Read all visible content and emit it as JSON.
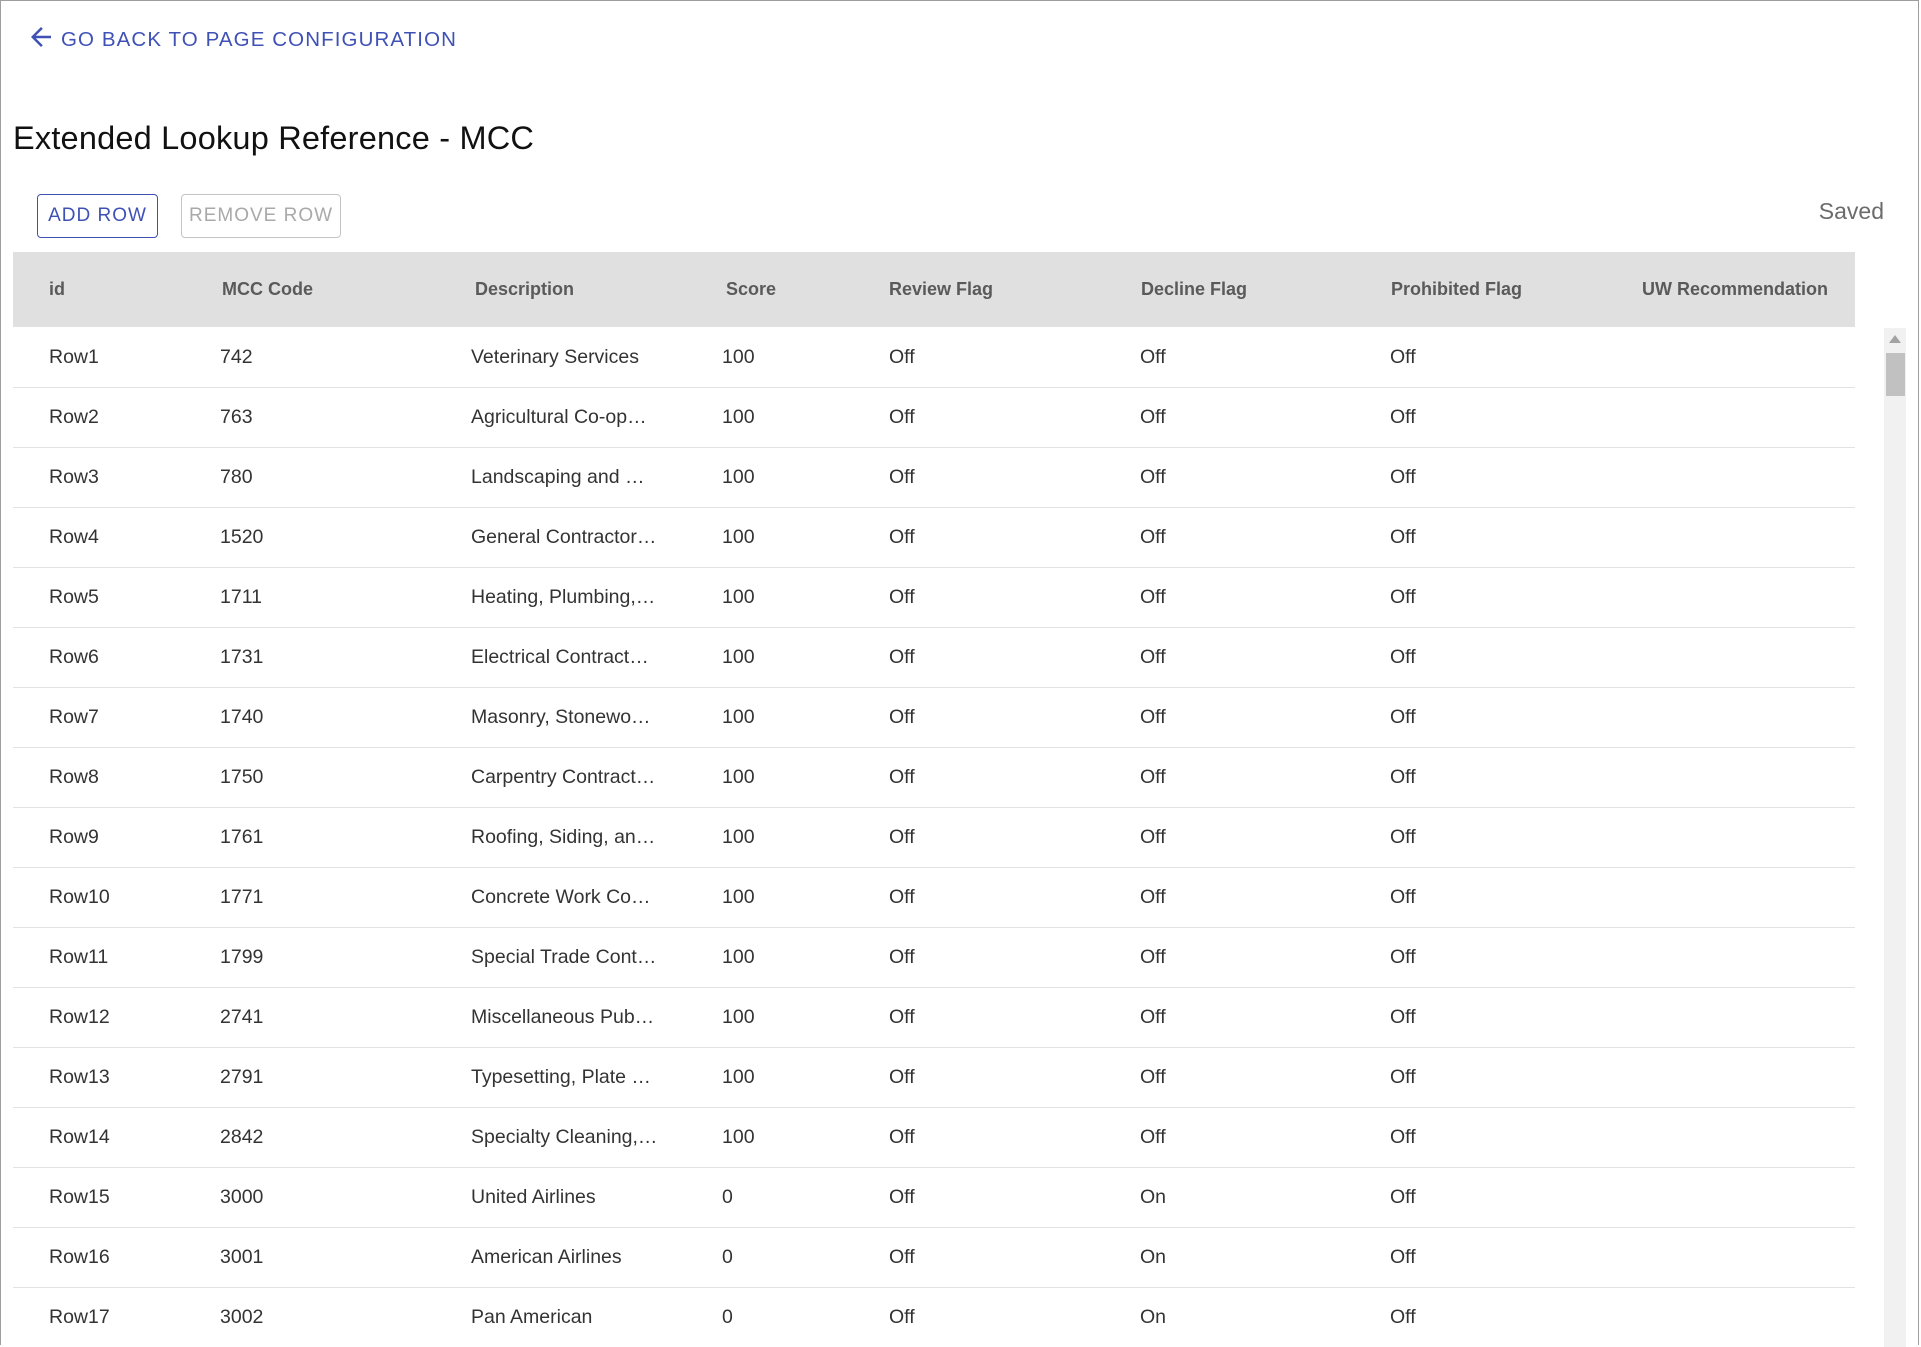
{
  "back_link": {
    "label": "GO BACK TO PAGE CONFIGURATION",
    "icon": "arrow-left-icon"
  },
  "page_title": "Extended Lookup Reference - MCC",
  "toolbar": {
    "add_row_label": "ADD ROW",
    "remove_row_label": "REMOVE ROW",
    "status": "Saved"
  },
  "colors": {
    "accent": "#3f51b5",
    "header_bg": "#e0e0e0",
    "disabled": "#a9a9a9"
  },
  "table": {
    "columns": [
      "id",
      "MCC Code",
      "Description",
      "Score",
      "Review Flag",
      "Decline Flag",
      "Prohibited Flag",
      "UW Recommendation"
    ],
    "rows": [
      [
        "Row1",
        "742",
        "Veterinary Services",
        "100",
        "Off",
        "Off",
        "Off",
        ""
      ],
      [
        "Row2",
        "763",
        "Agricultural Co-op…",
        "100",
        "Off",
        "Off",
        "Off",
        ""
      ],
      [
        "Row3",
        "780",
        "Landscaping and …",
        "100",
        "Off",
        "Off",
        "Off",
        ""
      ],
      [
        "Row4",
        "1520",
        "General Contractor…",
        "100",
        "Off",
        "Off",
        "Off",
        ""
      ],
      [
        "Row5",
        "1711",
        "Heating, Plumbing,…",
        "100",
        "Off",
        "Off",
        "Off",
        ""
      ],
      [
        "Row6",
        "1731",
        "Electrical Contract…",
        "100",
        "Off",
        "Off",
        "Off",
        ""
      ],
      [
        "Row7",
        "1740",
        "Masonry, Stonewo…",
        "100",
        "Off",
        "Off",
        "Off",
        ""
      ],
      [
        "Row8",
        "1750",
        "Carpentry Contract…",
        "100",
        "Off",
        "Off",
        "Off",
        ""
      ],
      [
        "Row9",
        "1761",
        "Roofing, Siding, an…",
        "100",
        "Off",
        "Off",
        "Off",
        ""
      ],
      [
        "Row10",
        "1771",
        "Concrete Work Co…",
        "100",
        "Off",
        "Off",
        "Off",
        ""
      ],
      [
        "Row11",
        "1799",
        "Special Trade Cont…",
        "100",
        "Off",
        "Off",
        "Off",
        ""
      ],
      [
        "Row12",
        "2741",
        "Miscellaneous Pub…",
        "100",
        "Off",
        "Off",
        "Off",
        ""
      ],
      [
        "Row13",
        "2791",
        "Typesetting, Plate …",
        "100",
        "Off",
        "Off",
        "Off",
        ""
      ],
      [
        "Row14",
        "2842",
        "Specialty Cleaning,…",
        "100",
        "Off",
        "Off",
        "Off",
        ""
      ],
      [
        "Row15",
        "3000",
        "United Airlines",
        "0",
        "Off",
        "On",
        "Off",
        ""
      ],
      [
        "Row16",
        "3001",
        "American Airlines",
        "0",
        "Off",
        "On",
        "Off",
        ""
      ],
      [
        "Row17",
        "3002",
        "Pan American",
        "0",
        "Off",
        "On",
        "Off",
        ""
      ]
    ]
  }
}
